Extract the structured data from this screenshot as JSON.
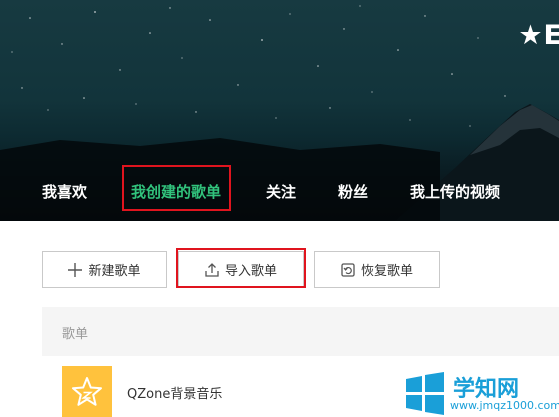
{
  "banner": {
    "title_fragment": "★E"
  },
  "nav": {
    "items": [
      {
        "label": "我喜欢"
      },
      {
        "label": "我创建的歌单"
      },
      {
        "label": "关注"
      },
      {
        "label": "粉丝"
      },
      {
        "label": "我上传的视频"
      }
    ],
    "active_index": 1
  },
  "toolbar": {
    "new_label": "新建歌单",
    "import_label": "导入歌单",
    "restore_label": "恢复歌单"
  },
  "list": {
    "header": "歌单",
    "items": [
      {
        "name": "QZone背景音乐"
      }
    ]
  },
  "watermark": {
    "text": "学知网",
    "url": "www.jmqz1000.com"
  },
  "colors": {
    "accent": "#31c27c",
    "highlight": "#e0141e",
    "cover": "#ffc23d"
  }
}
